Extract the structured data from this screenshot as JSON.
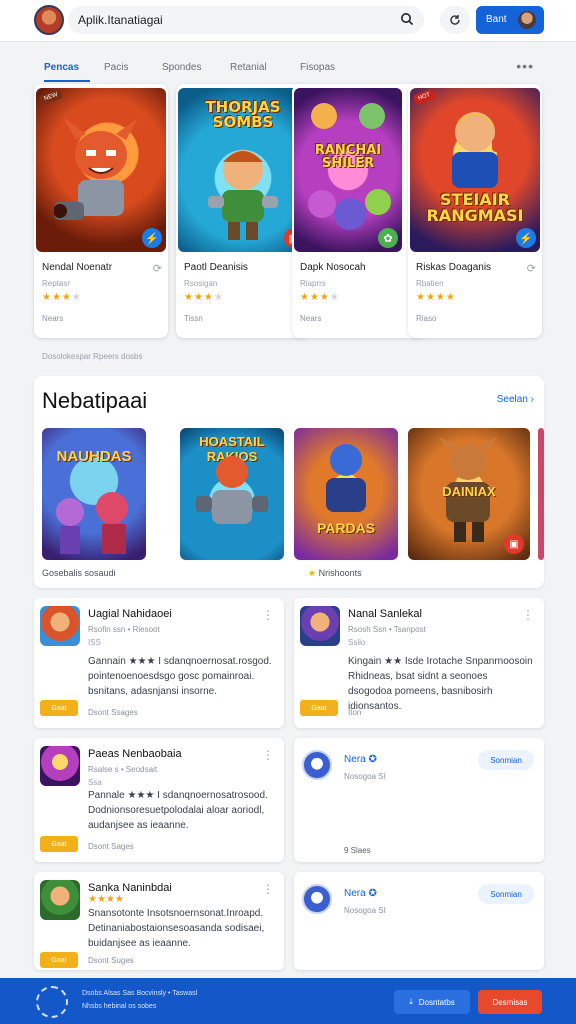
{
  "header": {
    "search_value": "Aplik.Itanatiagai",
    "login_label": "Bant"
  },
  "tabs": {
    "items": [
      "Pencas",
      "Pacis",
      "Spondes",
      "Retanial",
      "Fisopas"
    ],
    "active": 0
  },
  "featured": [
    {
      "name": "Nendal Noenatr",
      "sub": "Reptasr",
      "rating": 3,
      "meta": "Nears",
      "art_text": "",
      "badge": "bolt"
    },
    {
      "name": "Paotl Deanisis",
      "sub": "Rsosigan",
      "rating": 3,
      "meta": "Tissn",
      "art_text": "THORJAS SOMBS",
      "badge": "cam"
    },
    {
      "name": "Dapk Nosocah",
      "sub": "Riaprrs",
      "rating": 3,
      "meta": "Nears",
      "art_text": "RANCHAI SHILER",
      "badge": "leaf"
    },
    {
      "name": "Riskas Doaganis",
      "sub": "Rbatien",
      "rating": 4,
      "meta": "Riaso",
      "art_text": "STEIAIR RANGMASI",
      "badge": "bolt"
    }
  ],
  "caption": "Dosolokespar Rpeers dosbs",
  "popular": {
    "title": "Nebatipaai",
    "see_all": "Seelan",
    "items": [
      {
        "art_text": "NAUHDAS"
      },
      {
        "art_text": "HOASTAIL RAKIOS"
      },
      {
        "art_text": "PARDAS"
      },
      {
        "art_text": "DAINIAX"
      }
    ],
    "caption_left": "Gosebalis sosaudi",
    "caption_right": "Nrishoonts"
  },
  "reviews": [
    {
      "title": "Uagial Nahidaoei",
      "meta": "Rsofin ssn • Riesoot",
      "count": "ISS",
      "body": "Gannain ★★★ I sdanqnoernosat.rosgod. pointenoenoesdsgo gosc pomainroai. bsnitans, adasnjansi insorne.",
      "tag": "Gaat",
      "foot": "Dsont Ssages"
    },
    {
      "title": "Nanal Sanlekal",
      "meta": "Rsosh Ssn • Tsanpost",
      "count": "Ssilo",
      "body": "Kingain ★★ Isde Irotache Snpanrnoosoin Rhidneas, bsat sidnt a seonoes dsogodoa pomeens, basnibosirh idionsantos.",
      "tag": "Gaat",
      "foot": "Iton"
    },
    {
      "title": "Paeas Nenbaobaia",
      "meta": "Rsalse s • Seodsait",
      "count": "Ssa",
      "body": "Pannale ★★★ I sdanqnoernosatrosood. Dodnionsoresuetpolodalai aloar aoriodl, audanjsee as ieaanne.",
      "tag": "Gaat",
      "foot": "Dsont Sages"
    },
    {
      "title": "Sanka Naninbdai",
      "meta": "",
      "count": "",
      "body": "Snansotonte Insotsnoernsonat.Inroapd. Detinaniabostaionsesoasanda sodisaei, buidanjsee as ieaanne.",
      "rating": 4,
      "tag": "Gaat",
      "foot": "Dsont Suges"
    }
  ],
  "users": [
    {
      "name": "Nera",
      "sub": "Nosogoa SI",
      "follow": "Sonmian",
      "likes": "9 Slaes"
    },
    {
      "name": "Nera",
      "sub": "Nosogoa SI",
      "follow": "Sonmian",
      "likes": ""
    }
  ],
  "bottom": {
    "line1": "Dsobs Alsas Sas Bocvinsly • Taswasl",
    "line2": "Nhsbs hebinal os sobes",
    "btn1": "Dosntatbs",
    "btn2": "Desmisas",
    "colors": {
      "primary": "#1457c9",
      "accent": "#e8492c"
    }
  }
}
